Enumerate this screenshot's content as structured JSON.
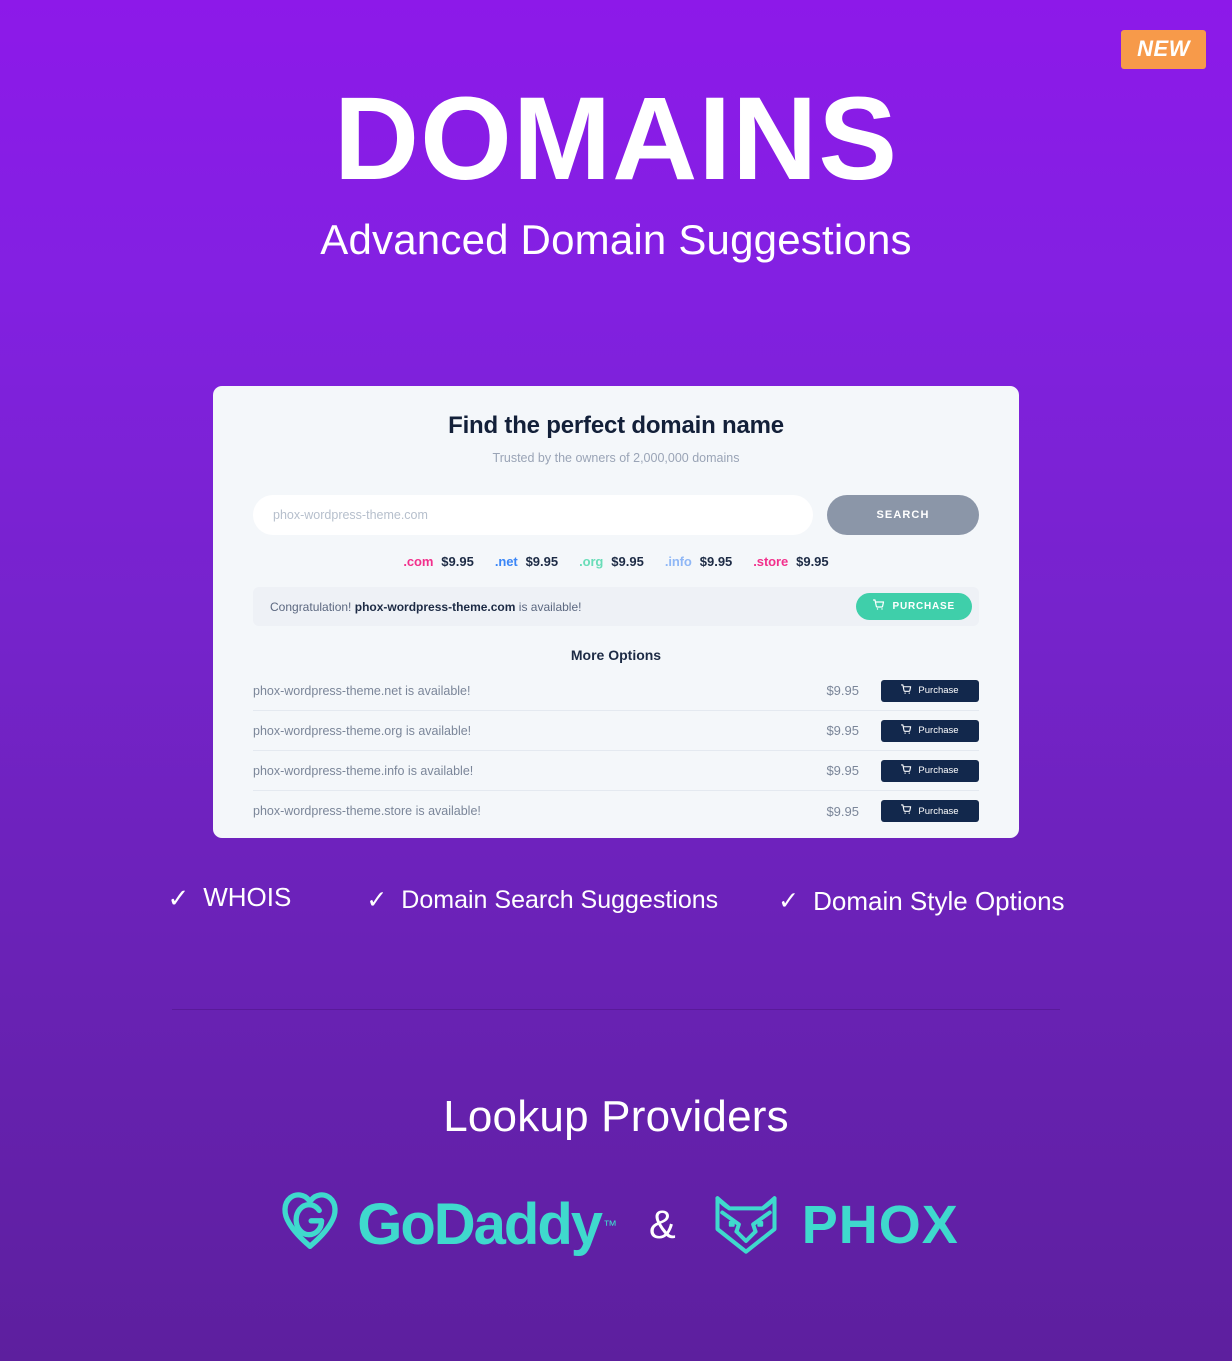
{
  "badge": {
    "label": "NEW",
    "color": "#f79a4a"
  },
  "hero": {
    "title": "DOMAINS",
    "subtitle": "Advanced Domain Suggestions"
  },
  "card": {
    "title": "Find the perfect domain name",
    "subtitle": "Trusted by the owners of 2,000,000 domains",
    "search": {
      "placeholder": "phox-wordpress-theme.com",
      "value": "",
      "button_label": "SEARCH"
    },
    "tlds": [
      {
        "name": ".com",
        "price": "$9.95",
        "color": "#f2308c"
      },
      {
        "name": ".net",
        "price": "$9.95",
        "color": "#3a86f7"
      },
      {
        "name": ".org",
        "price": "$9.95",
        "color": "#69ddb8"
      },
      {
        "name": ".info",
        "price": "$9.95",
        "color": "#8fb7f6"
      },
      {
        "name": ".store",
        "price": "$9.95",
        "color": "#f2308c"
      }
    ],
    "banner": {
      "prefix": "Congratulation! ",
      "domain": "phox-wordpress-theme.com",
      "suffix": " is available!",
      "button_label": "PURCHASE",
      "button_color": "#3fcfaa"
    },
    "more_options_title": "More Options",
    "options": [
      {
        "domain": "phox-wordpress-theme.net is available!",
        "price": "$9.95",
        "button_label": "Purchase"
      },
      {
        "domain": "phox-wordpress-theme.org is available!",
        "price": "$9.95",
        "button_label": "Purchase"
      },
      {
        "domain": "phox-wordpress-theme.info is available!",
        "price": "$9.95",
        "button_label": "Purchase"
      },
      {
        "domain": "phox-wordpress-theme.store is available!",
        "price": "$9.95",
        "button_label": "Purchase"
      }
    ]
  },
  "features": [
    {
      "label": "WHOIS",
      "check": "✓"
    },
    {
      "label": "Domain Search Suggestions",
      "check": "✓"
    },
    {
      "label": "Domain Style Options",
      "check": "✓"
    }
  ],
  "providers": {
    "title": "Lookup Providers",
    "separator": "&",
    "items": [
      {
        "name": "GoDaddy",
        "trademark": "™",
        "color": "#3fd9cd"
      },
      {
        "name": "PHOX",
        "color": "#3fd9cd"
      }
    ]
  },
  "theme": {
    "bg_top": "#8d19e9",
    "bg_bottom": "#5d1f9e",
    "card_bg": "#f4f7fa",
    "navy": "#12284c",
    "accent_teal": "#3fd9cd"
  }
}
